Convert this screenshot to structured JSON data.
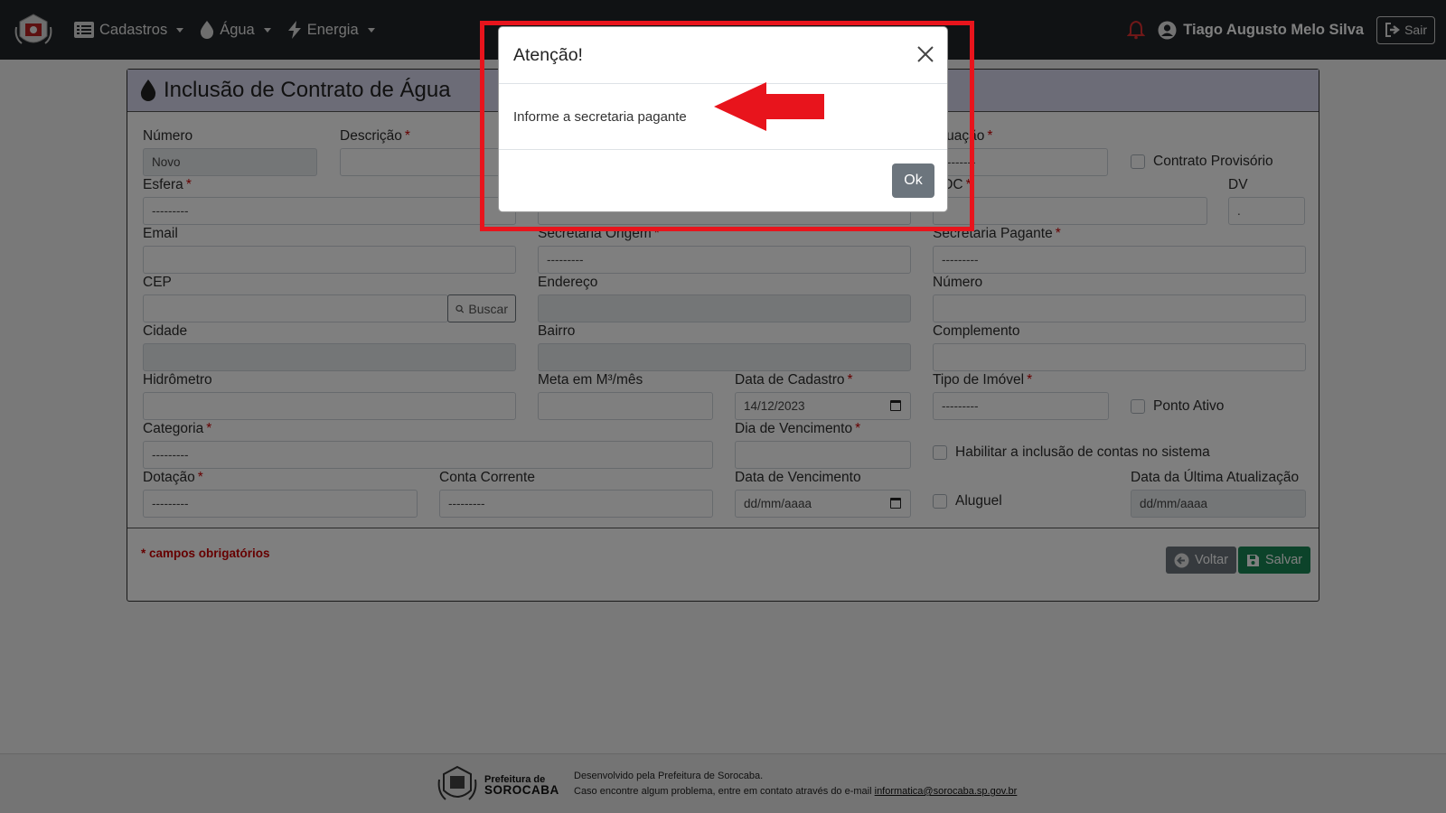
{
  "navbar": {
    "menus": [
      {
        "label": "Cadastros",
        "icon": "list-icon"
      },
      {
        "label": "Água",
        "icon": "water-drop-icon"
      },
      {
        "label": "Energia",
        "icon": "lightning-icon"
      }
    ],
    "user_name": "Tiago Augusto Melo Silva",
    "logout_label": "Sair"
  },
  "form": {
    "title": "Inclusão de Contrato de Água",
    "fields": {
      "numero": {
        "label": "Número",
        "value": "Novo"
      },
      "descricao": {
        "label": "Descrição",
        "value": ""
      },
      "situacao": {
        "label": "Situação",
        "value": "---------"
      },
      "contrato_provisorio": {
        "label": "Contrato Provisório"
      },
      "esfera": {
        "label": "Esfera",
        "value": "---------"
      },
      "fornecedor": {
        "value": "---------"
      },
      "rdc": {
        "label": "RDC",
        "value": ""
      },
      "dv": {
        "label": "DV",
        "value": "."
      },
      "email": {
        "label": "Email",
        "value": ""
      },
      "secretaria_origem": {
        "label": "Secretaria Origem",
        "value": "---------"
      },
      "secretaria_pagante": {
        "label": "Secretaria Pagante",
        "value": "---------"
      },
      "cep": {
        "label": "CEP",
        "value": "",
        "button": "Buscar"
      },
      "endereco": {
        "label": "Endereço",
        "value": ""
      },
      "numero_end": {
        "label": "Número",
        "value": ""
      },
      "cidade": {
        "label": "Cidade",
        "value": ""
      },
      "bairro": {
        "label": "Bairro",
        "value": ""
      },
      "complemento": {
        "label": "Complemento",
        "value": ""
      },
      "hidrometro": {
        "label": "Hidrômetro",
        "value": ""
      },
      "meta": {
        "label": "Meta em M³/mês",
        "value": ""
      },
      "data_cadastro": {
        "label": "Data de Cadastro",
        "value": "14/12/2023"
      },
      "tipo_imovel": {
        "label": "Tipo de Imóvel",
        "value": "---------"
      },
      "ponto_ativo": {
        "label": "Ponto Ativo"
      },
      "categoria": {
        "label": "Categoria",
        "value": "---------"
      },
      "dia_vencimento": {
        "label": "Dia de Vencimento",
        "value": ""
      },
      "habilitar": {
        "label": "Habilitar a inclusão de contas no sistema"
      },
      "dotacao": {
        "label": "Dotação",
        "value": "---------"
      },
      "conta_corrente": {
        "label": "Conta Corrente",
        "value": "---------"
      },
      "data_vencimento": {
        "label": "Data de Vencimento",
        "value": "dd/mm/aaaa"
      },
      "aluguel": {
        "label": "Aluguel"
      },
      "data_ultima": {
        "label": "Data da Última Atualização",
        "value": "dd/mm/aaaa"
      }
    },
    "required_note": "* campos obrigatórios",
    "back_label": "Voltar",
    "save_label": "Salvar"
  },
  "modal": {
    "title": "Atenção!",
    "message": "Informe a secretaria pagante",
    "ok_label": "Ok"
  },
  "footer": {
    "brand_line1": "Prefeitura de",
    "brand_line2": "SOROCABA",
    "line1": "Desenvolvido pela Prefeitura de Sorocaba.",
    "line2": "Caso encontre algum problema, entre em contato através do e-mail",
    "email": "informatica@sorocaba.sp.gov.br"
  },
  "colors": {
    "navbar": "#212529",
    "card_header": "#d8d8ee",
    "required": "#cc0000",
    "save": "#198754",
    "secondary": "#6c757d",
    "annotation": "#e8141c"
  }
}
